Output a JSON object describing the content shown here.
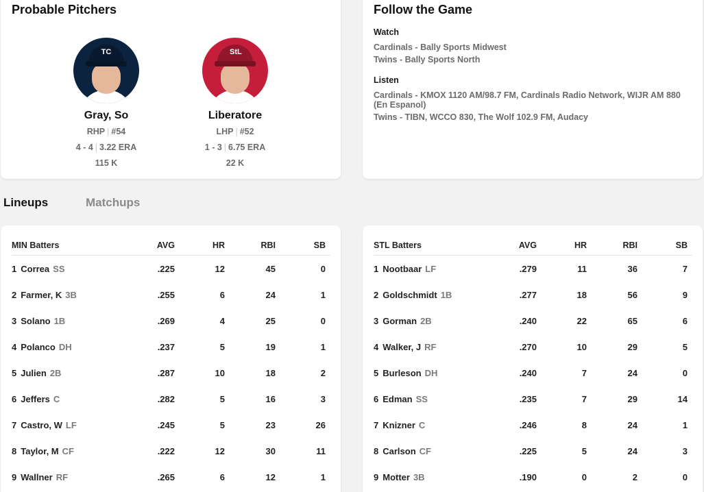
{
  "probable_pitchers": {
    "title": "Probable Pitchers",
    "pitchers": [
      {
        "name": "Gray, So",
        "throws": "RHP",
        "number": "#54",
        "record": "4 - 4",
        "era": "3.22 ERA",
        "strikeouts": "115 K",
        "cap_color": "#0c2340",
        "shirt_color": "#ffffff",
        "bg_color": "#0c2340",
        "logo": "TC"
      },
      {
        "name": "Liberatore",
        "throws": "LHP",
        "number": "#52",
        "record": "1 - 3",
        "era": "6.75 ERA",
        "strikeouts": "22 K",
        "cap_color": "#c41e3a",
        "shirt_color": "#ffffff",
        "bg_color": "#c41e3a",
        "logo": "StL"
      }
    ]
  },
  "follow_the_game": {
    "title": "Follow the Game",
    "watch": {
      "heading": "Watch",
      "lines": [
        "Cardinals - Bally Sports Midwest",
        "Twins - Bally Sports North"
      ]
    },
    "listen": {
      "heading": "Listen",
      "lines": [
        "Cardinals - KMOX 1120 AM/98.7 FM, Cardinals Radio Network, WIJR AM 880 (En Espanol)",
        "Twins - TIBN, WCCO 830, The Wolf 102.9 FM, Audacy"
      ]
    }
  },
  "tabs": {
    "lineups": "Lineups",
    "matchups": "Matchups"
  },
  "lineups": {
    "min": {
      "header": {
        "team": "MIN Batters",
        "avg": "AVG",
        "hr": "HR",
        "rbi": "RBI",
        "sb": "SB"
      },
      "rows": [
        {
          "order": "1",
          "name": "Correa",
          "pos": "SS",
          "avg": ".225",
          "hr": "12",
          "rbi": "45",
          "sb": "0"
        },
        {
          "order": "2",
          "name": "Farmer, K",
          "pos": "3B",
          "avg": ".255",
          "hr": "6",
          "rbi": "24",
          "sb": "1"
        },
        {
          "order": "3",
          "name": "Solano",
          "pos": "1B",
          "avg": ".269",
          "hr": "4",
          "rbi": "25",
          "sb": "0"
        },
        {
          "order": "4",
          "name": "Polanco",
          "pos": "DH",
          "avg": ".237",
          "hr": "5",
          "rbi": "19",
          "sb": "1"
        },
        {
          "order": "5",
          "name": "Julien",
          "pos": "2B",
          "avg": ".287",
          "hr": "10",
          "rbi": "18",
          "sb": "2"
        },
        {
          "order": "6",
          "name": "Jeffers",
          "pos": "C",
          "avg": ".282",
          "hr": "5",
          "rbi": "16",
          "sb": "3"
        },
        {
          "order": "7",
          "name": "Castro, W",
          "pos": "LF",
          "avg": ".245",
          "hr": "5",
          "rbi": "23",
          "sb": "26"
        },
        {
          "order": "8",
          "name": "Taylor, M",
          "pos": "CF",
          "avg": ".222",
          "hr": "12",
          "rbi": "30",
          "sb": "11"
        },
        {
          "order": "9",
          "name": "Wallner",
          "pos": "RF",
          "avg": ".265",
          "hr": "6",
          "rbi": "12",
          "sb": "1"
        }
      ]
    },
    "stl": {
      "header": {
        "team": "STL Batters",
        "avg": "AVG",
        "hr": "HR",
        "rbi": "RBI",
        "sb": "SB"
      },
      "rows": [
        {
          "order": "1",
          "name": "Nootbaar",
          "pos": "LF",
          "avg": ".279",
          "hr": "11",
          "rbi": "36",
          "sb": "7"
        },
        {
          "order": "2",
          "name": "Goldschmidt",
          "pos": "1B",
          "avg": ".277",
          "hr": "18",
          "rbi": "56",
          "sb": "9"
        },
        {
          "order": "3",
          "name": "Gorman",
          "pos": "2B",
          "avg": ".240",
          "hr": "22",
          "rbi": "65",
          "sb": "6"
        },
        {
          "order": "4",
          "name": "Walker, J",
          "pos": "RF",
          "avg": ".270",
          "hr": "10",
          "rbi": "29",
          "sb": "5"
        },
        {
          "order": "5",
          "name": "Burleson",
          "pos": "DH",
          "avg": ".240",
          "hr": "7",
          "rbi": "24",
          "sb": "0"
        },
        {
          "order": "6",
          "name": "Edman",
          "pos": "SS",
          "avg": ".235",
          "hr": "7",
          "rbi": "29",
          "sb": "14"
        },
        {
          "order": "7",
          "name": "Knizner",
          "pos": "C",
          "avg": ".246",
          "hr": "8",
          "rbi": "24",
          "sb": "1"
        },
        {
          "order": "8",
          "name": "Carlson",
          "pos": "CF",
          "avg": ".225",
          "hr": "5",
          "rbi": "24",
          "sb": "3"
        },
        {
          "order": "9",
          "name": "Motter",
          "pos": "3B",
          "avg": ".190",
          "hr": "0",
          "rbi": "2",
          "sb": "0"
        }
      ]
    }
  }
}
